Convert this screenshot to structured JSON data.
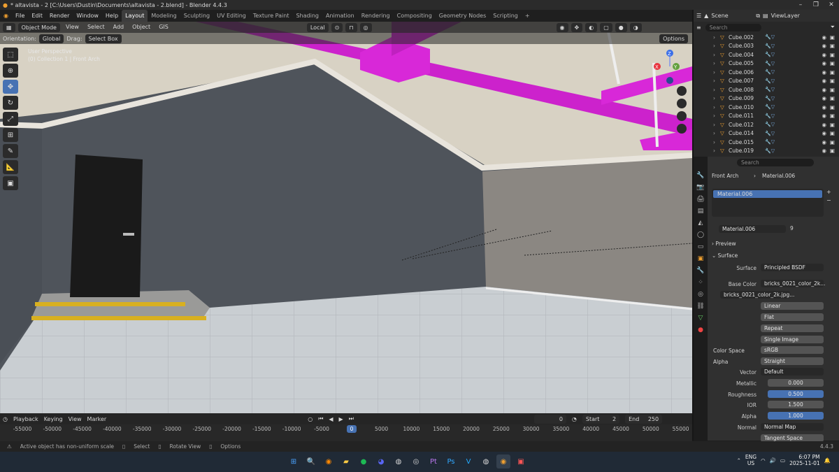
{
  "window": {
    "title": "* altavista - 2 [C:\\Users\\Dustin\\Documents\\altavista - 2.blend] - Blender 4.4.3"
  },
  "menu": {
    "items": [
      "File",
      "Edit",
      "Render",
      "Window",
      "Help"
    ],
    "workspaces": [
      "Layout",
      "Modeling",
      "Sculpting",
      "UV Editing",
      "Texture Paint",
      "Shading",
      "Animation",
      "Rendering",
      "Compositing",
      "Geometry Nodes",
      "Scripting"
    ],
    "add_tab": "+",
    "active_workspace": "Layout"
  },
  "scene": {
    "label": "Scene",
    "view_layer": "ViewLayer"
  },
  "viewport": {
    "mode": "Object Mode",
    "menus": [
      "View",
      "Select",
      "Add",
      "Object",
      "GIS"
    ],
    "pivot": "Local",
    "orientation_label": "Orientation:",
    "orientation": "Global",
    "drag_label": "Drag:",
    "drag": "Select Box",
    "options": "Options",
    "info_line1": "User Perspective",
    "info_line2": "(0) Collection 1 | Front Arch"
  },
  "outliner": {
    "search_placeholder": "Search",
    "rows": [
      {
        "name": "Cube.002"
      },
      {
        "name": "Cube.003"
      },
      {
        "name": "Cube.004"
      },
      {
        "name": "Cube.005"
      },
      {
        "name": "Cube.006"
      },
      {
        "name": "Cube.007"
      },
      {
        "name": "Cube.008"
      },
      {
        "name": "Cube.009"
      },
      {
        "name": "Cube.010"
      },
      {
        "name": "Cube.011"
      },
      {
        "name": "Cube.012"
      },
      {
        "name": "Cube.014"
      },
      {
        "name": "Cube.015"
      },
      {
        "name": "Cube.019"
      }
    ]
  },
  "properties": {
    "search_placeholder": "Search",
    "breadcrumb_object": "Front Arch",
    "breadcrumb_material": "Material.006",
    "slot": "Material.006",
    "material_name": "Material.006",
    "users": "9",
    "sections": {
      "preview": "Preview",
      "surface": "Surface"
    },
    "surface_label": "Surface",
    "surface_value": "Principled BSDF",
    "base_color_label": "Base Color",
    "base_color_value": "bricks_0021_color_2k...",
    "image_name": "bricks_0021_color_2k.jpg...",
    "interpolation": "Linear",
    "projection": "Flat",
    "extension": "Repeat",
    "source": "Single Image",
    "color_space_label": "Color Space",
    "color_space": "sRGB",
    "alpha_mode_label": "Alpha",
    "alpha_mode": "Straight",
    "vector_label": "Vector",
    "vector_value": "Default",
    "metallic_label": "Metallic",
    "metallic": "0.000",
    "roughness_label": "Roughness",
    "roughness": "0.500",
    "ior_label": "IOR",
    "ior": "1.500",
    "alpha_label": "Alpha",
    "alpha": "1.000",
    "normal_label": "Normal",
    "normal_value": "Normal Map",
    "tangent": "Tangent Space"
  },
  "timeline": {
    "menus": [
      "Playback",
      "Keying",
      "View",
      "Marker"
    ],
    "current_frame": "0",
    "start_label": "Start",
    "start": "2",
    "end_label": "End",
    "end": "250",
    "ruler": [
      "-55000",
      "-50000",
      "-45000",
      "-40000",
      "-35000",
      "-30000",
      "-25000",
      "-20000",
      "-15000",
      "-10000",
      "-5000",
      "0",
      "5000",
      "10000",
      "15000",
      "20000",
      "25000",
      "30000",
      "35000",
      "40000",
      "45000",
      "50000",
      "55000"
    ],
    "playhead": "0"
  },
  "status": {
    "warning": "Active object has non-uniform scale",
    "select": "Select",
    "rotate": "Rotate View",
    "options": "Options",
    "version": "4.4.3"
  },
  "taskbar": {
    "lang": "ENG",
    "region": "US",
    "time": "6:07 PM",
    "date": "2025-11-01"
  },
  "colors": {
    "accent": "#4772b3",
    "duct": "#d020d0",
    "wall": "#50555c"
  }
}
